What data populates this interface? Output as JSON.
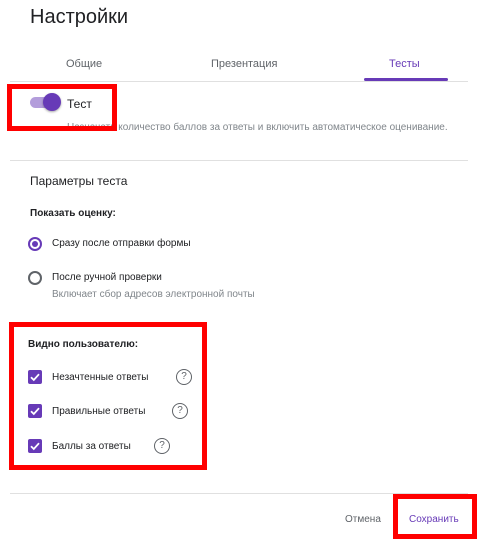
{
  "dialog": {
    "title": "Настройки",
    "tabs": [
      {
        "label": "Общие"
      },
      {
        "label": "Презентация"
      },
      {
        "label": "Тесты",
        "active": true
      }
    ],
    "quiz_toggle": {
      "label": "Тест",
      "description": "Назначать количество баллов за ответы и включить автоматическое оценивание.",
      "on": true
    },
    "quiz_params": {
      "title": "Параметры теста",
      "show_score_label": "Показать оценку:",
      "options": [
        {
          "label": "Сразу после отправки формы",
          "selected": true
        },
        {
          "label": "После ручной проверки",
          "sub": "Включает сбор адресов электронной почты",
          "selected": false
        }
      ]
    },
    "respondent_can_see": {
      "label": "Видно пользователю:",
      "items": [
        {
          "label": "Незачтенные ответы",
          "checked": true
        },
        {
          "label": "Правильные ответы",
          "checked": true
        },
        {
          "label": "Баллы за ответы",
          "checked": true
        }
      ]
    },
    "footer": {
      "cancel_label": "Отмена",
      "save_label": "Сохранить"
    }
  },
  "colors": {
    "accent": "#673ab7",
    "highlight": "#ff0000",
    "muted_text": "#80868b"
  }
}
